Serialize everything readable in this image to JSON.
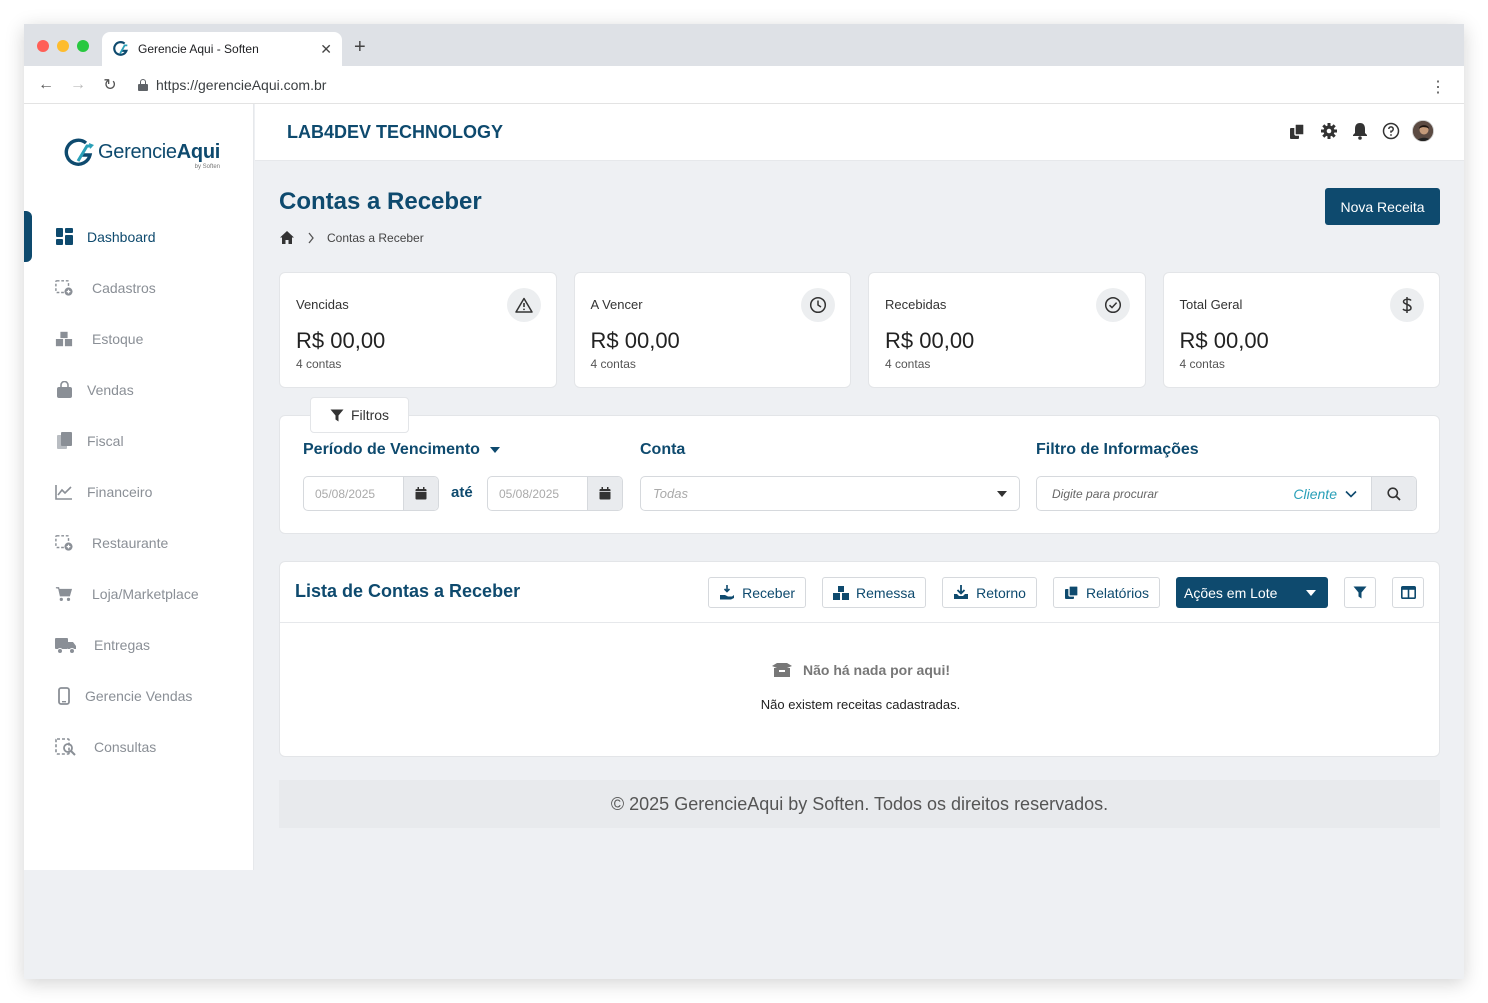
{
  "browser": {
    "tab_title": "Gerencie Aqui - Soften",
    "url": "https://gerencieAqui.com.br",
    "new_tab_label": "+"
  },
  "colors": {
    "primary": "#0e4a6e",
    "accent": "#2aa0b8",
    "muted": "#8a8f96",
    "background": "#eef0f3"
  },
  "logo": {
    "text_gerencie": "Gerencie",
    "text_aqui": "Aqui",
    "sub": "by Soften"
  },
  "sidebar": {
    "items": [
      {
        "label": "Dashboard",
        "icon": "grid-icon",
        "active": true
      },
      {
        "label": "Cadastros",
        "icon": "register-icon"
      },
      {
        "label": "Estoque",
        "icon": "boxes-icon"
      },
      {
        "label": "Vendas",
        "icon": "shopping-bag-icon"
      },
      {
        "label": "Fiscal",
        "icon": "documents-icon"
      },
      {
        "label": "Financeiro",
        "icon": "line-chart-icon"
      },
      {
        "label": "Restaurante",
        "icon": "register-icon"
      },
      {
        "label": "Loja/Marketplace",
        "icon": "cart-icon"
      },
      {
        "label": "Entregas",
        "icon": "truck-icon"
      },
      {
        "label": "Gerencie Vendas",
        "icon": "mobile-icon"
      },
      {
        "label": "Consultas",
        "icon": "search-document-icon"
      }
    ]
  },
  "topbar": {
    "company": "LAB4DEV TECHNOLOGY",
    "icons": [
      "copy-icon",
      "gear-icon",
      "bell-icon",
      "help-icon",
      "avatar"
    ]
  },
  "page": {
    "title": "Contas a Receber",
    "breadcrumb": "Contas a Receber",
    "new_button": "Nova Receita"
  },
  "cards": [
    {
      "title": "Vencidas",
      "value": "R$ 00,00",
      "sub": "4 contas",
      "icon": "warning-icon"
    },
    {
      "title": "A Vencer",
      "value": "R$ 00,00",
      "sub": "4 contas",
      "icon": "clock-icon"
    },
    {
      "title": "Recebidas",
      "value": "R$ 00,00",
      "sub": "4 contas",
      "icon": "check-circle-icon"
    },
    {
      "title": "Total Geral",
      "value": "R$ 00,00",
      "sub": "4 contas",
      "icon": "dollar-icon"
    }
  ],
  "filters": {
    "tab_label": "Filtros",
    "periodo_label": "Período de Vencimento",
    "date_from": "05/08/2025",
    "date_to": "05/08/2025",
    "ate": "até",
    "conta_label": "Conta",
    "conta_value": "Todas",
    "info_label": "Filtro de Informações",
    "search_placeholder": "Digite para procurar",
    "search_scope": "Cliente"
  },
  "list": {
    "title": "Lista de Contas a Receber",
    "buttons": {
      "receber": "Receber",
      "remessa": "Remessa",
      "retorno": "Retorno",
      "relatorios": "Relatórios",
      "acoes": "Ações em Lote"
    },
    "empty_title": "Não há nada por aqui!",
    "empty_sub": "Não existem receitas cadastradas."
  },
  "footer": "© 2025 GerencieAqui by Soften. Todos os direitos reservados."
}
